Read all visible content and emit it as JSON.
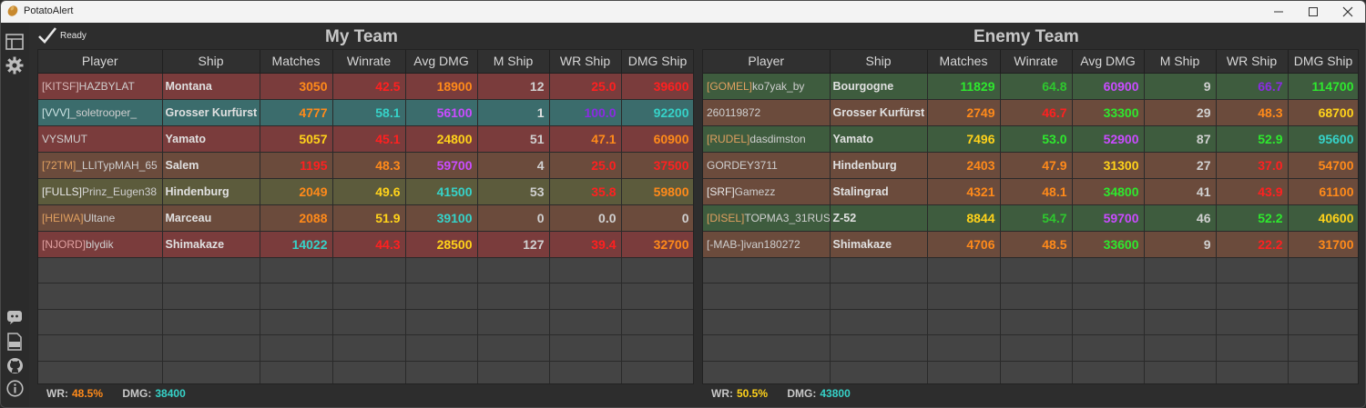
{
  "window": {
    "title": "PotatoAlert"
  },
  "status": {
    "text": "Ready"
  },
  "colors": {
    "red_row": "#7a3a3a",
    "teal_row": "#3d6b6b",
    "brown_row": "#6b4a3a",
    "olive_row": "#5c5a3a",
    "green_row": "#3e5a3e",
    "empty_row": "#444444"
  },
  "headers": [
    "Player",
    "Ship",
    "Matches",
    "Winrate",
    "Avg DMG",
    "M Ship",
    "WR Ship",
    "DMG Ship"
  ],
  "my_team": {
    "title": "My Team",
    "rows": [
      {
        "bg": "#7a3c3c",
        "clan": "[KITSF]",
        "clan_color": "#d8b8b8",
        "name": "HAZBYLAT",
        "ship": "Montana",
        "cells": [
          [
            "3050",
            "#ff8a1a"
          ],
          [
            "42.5",
            "#ff2020"
          ],
          [
            "18900",
            "#ff8a1a"
          ],
          [
            "12",
            "#d0d0d0"
          ],
          [
            "25.0",
            "#ff2020"
          ],
          [
            "39600",
            "#ff2020"
          ]
        ]
      },
      {
        "bg": "#3b6c6c",
        "clan": "[VVV]",
        "clan_color": "#cfe6e6",
        "name": "_soletrooper_",
        "ship": "Grosser Kurfürst",
        "cells": [
          [
            "4777",
            "#ff8a1a"
          ],
          [
            "58.1",
            "#36d2c8"
          ],
          [
            "56100",
            "#c94cff"
          ],
          [
            "1",
            "#e0e0e0"
          ],
          [
            "100.0",
            "#8a2be2"
          ],
          [
            "92200",
            "#36d2c8"
          ]
        ]
      },
      {
        "bg": "#7a3c3c",
        "clan": "",
        "clan_color": "#d8b8b8",
        "name": "VYSMUT",
        "ship": "Yamato",
        "cells": [
          [
            "5057",
            "#ffd21a"
          ],
          [
            "45.1",
            "#ff2020"
          ],
          [
            "24800",
            "#ffd21a"
          ],
          [
            "51",
            "#d0d0d0"
          ],
          [
            "47.1",
            "#ff8a1a"
          ],
          [
            "60900",
            "#ff8a1a"
          ]
        ]
      },
      {
        "bg": "#6b4b3c",
        "clan": "[72TM]",
        "clan_color": "#e0a060",
        "name": "_LLITypMAH_65",
        "ship": "Salem",
        "cells": [
          [
            "1195",
            "#ff2020"
          ],
          [
            "48.3",
            "#ff8a1a"
          ],
          [
            "59700",
            "#c94cff"
          ],
          [
            "4",
            "#d0d0d0"
          ],
          [
            "25.0",
            "#ff2020"
          ],
          [
            "37500",
            "#ff2020"
          ]
        ]
      },
      {
        "bg": "#5c5b3c",
        "clan": "[FULLS]",
        "clan_color": "#e8e8e8",
        "name": "Prinz_Eugen38",
        "ship": "Hindenburg",
        "cells": [
          [
            "2049",
            "#ff8a1a"
          ],
          [
            "49.6",
            "#ffd21a"
          ],
          [
            "41500",
            "#36d2c8"
          ],
          [
            "53",
            "#d0d0d0"
          ],
          [
            "35.8",
            "#ff2020"
          ],
          [
            "59800",
            "#ff8a1a"
          ]
        ]
      },
      {
        "bg": "#6b4b3c",
        "clan": "[HEIWA]",
        "clan_color": "#e0a060",
        "name": "Ultane",
        "ship": "Marceau",
        "cells": [
          [
            "2088",
            "#ff8a1a"
          ],
          [
            "51.9",
            "#ffd21a"
          ],
          [
            "39100",
            "#36d2c8"
          ],
          [
            "0",
            "#d0d0d0"
          ],
          [
            "0.0",
            "#d0d0d0"
          ],
          [
            "0",
            "#d0d0d0"
          ]
        ]
      },
      {
        "bg": "#7a3c3c",
        "clan": "[NJORD]",
        "clan_color": "#e0a0a0",
        "name": "blydik",
        "ship": "Shimakaze",
        "cells": [
          [
            "14022",
            "#36d2c8"
          ],
          [
            "44.3",
            "#ff2020"
          ],
          [
            "28500",
            "#ffd21a"
          ],
          [
            "127",
            "#d0d0d0"
          ],
          [
            "39.4",
            "#ff2020"
          ],
          [
            "32700",
            "#ff8a1a"
          ]
        ]
      }
    ],
    "footer": {
      "wr_label": "WR:",
      "wr_value": "48.5%",
      "wr_color": "#ff8a1a",
      "dmg_label": "DMG:",
      "dmg_value": "38400",
      "dmg_color": "#36d2c8"
    }
  },
  "enemy_team": {
    "title": "Enemy Team",
    "rows": [
      {
        "bg": "#3e5c3e",
        "clan": "[GOMEL]",
        "clan_color": "#e0a060",
        "name": "ko7yak_by",
        "ship": "Bourgogne",
        "cells": [
          [
            "11829",
            "#2ee82e"
          ],
          [
            "64.8",
            "#2ec82e"
          ],
          [
            "60900",
            "#c94cff"
          ],
          [
            "9",
            "#d0d0d0"
          ],
          [
            "66.7",
            "#8a2be2"
          ],
          [
            "114700",
            "#2ee82e"
          ]
        ]
      },
      {
        "bg": "#6b4b3c",
        "clan": "",
        "clan_color": "#cfcfcf",
        "name": "260119872",
        "ship": "Grosser Kurfürst",
        "cells": [
          [
            "2749",
            "#ff8a1a"
          ],
          [
            "46.7",
            "#ff2020"
          ],
          [
            "33300",
            "#2ee82e"
          ],
          [
            "29",
            "#d0d0d0"
          ],
          [
            "48.3",
            "#ff8a1a"
          ],
          [
            "68700",
            "#ffd21a"
          ]
        ]
      },
      {
        "bg": "#3e5c3e",
        "clan": "[RUDEL]",
        "clan_color": "#e0a060",
        "name": "dasdimston",
        "ship": "Yamato",
        "cells": [
          [
            "7496",
            "#ffd21a"
          ],
          [
            "53.0",
            "#2ee82e"
          ],
          [
            "52900",
            "#c94cff"
          ],
          [
            "87",
            "#d0d0d0"
          ],
          [
            "52.9",
            "#2ee82e"
          ],
          [
            "95600",
            "#36d2c8"
          ]
        ]
      },
      {
        "bg": "#6b4b3c",
        "clan": "",
        "clan_color": "#cfcfcf",
        "name": "GORDEY3711",
        "ship": "Hindenburg",
        "cells": [
          [
            "2403",
            "#ff8a1a"
          ],
          [
            "47.9",
            "#ff8a1a"
          ],
          [
            "31300",
            "#ffd21a"
          ],
          [
            "27",
            "#d0d0d0"
          ],
          [
            "37.0",
            "#ff2020"
          ],
          [
            "54700",
            "#ff8a1a"
          ]
        ]
      },
      {
        "bg": "#6b4b3c",
        "clan": "[SRF]",
        "clan_color": "#e8e8e8",
        "name": "Gamezz",
        "ship": "Stalingrad",
        "cells": [
          [
            "4321",
            "#ff8a1a"
          ],
          [
            "48.1",
            "#ff8a1a"
          ],
          [
            "34800",
            "#2ee82e"
          ],
          [
            "41",
            "#d0d0d0"
          ],
          [
            "43.9",
            "#ff2020"
          ],
          [
            "61100",
            "#ff8a1a"
          ]
        ]
      },
      {
        "bg": "#3e5c3e",
        "clan": "[DISEL]",
        "clan_color": "#e0a060",
        "name": "TOPMA3_31RUS",
        "ship": "Z-52",
        "cells": [
          [
            "8844",
            "#ffd21a"
          ],
          [
            "54.7",
            "#2ec82e"
          ],
          [
            "59700",
            "#c94cff"
          ],
          [
            "46",
            "#d0d0d0"
          ],
          [
            "52.2",
            "#2ee82e"
          ],
          [
            "40600",
            "#ffd21a"
          ]
        ]
      },
      {
        "bg": "#6b4b3c",
        "clan": "[-MAB-]",
        "clan_color": "#cfcfcf",
        "name": "ivan180272",
        "ship": "Shimakaze",
        "cells": [
          [
            "4706",
            "#ff8a1a"
          ],
          [
            "48.5",
            "#ff8a1a"
          ],
          [
            "33600",
            "#2ee82e"
          ],
          [
            "9",
            "#d0d0d0"
          ],
          [
            "22.2",
            "#ff2020"
          ],
          [
            "31700",
            "#ff8a1a"
          ]
        ]
      }
    ],
    "footer": {
      "wr_label": "WR:",
      "wr_value": "50.5%",
      "wr_color": "#ffd21a",
      "dmg_label": "DMG:",
      "dmg_value": "43800",
      "dmg_color": "#36d2c8"
    }
  },
  "sidebar": {
    "top_icons": [
      "table-icon",
      "settings-gear-icon"
    ],
    "bottom_icons": [
      "discord-icon",
      "log-icon",
      "github-icon",
      "info-icon"
    ]
  }
}
